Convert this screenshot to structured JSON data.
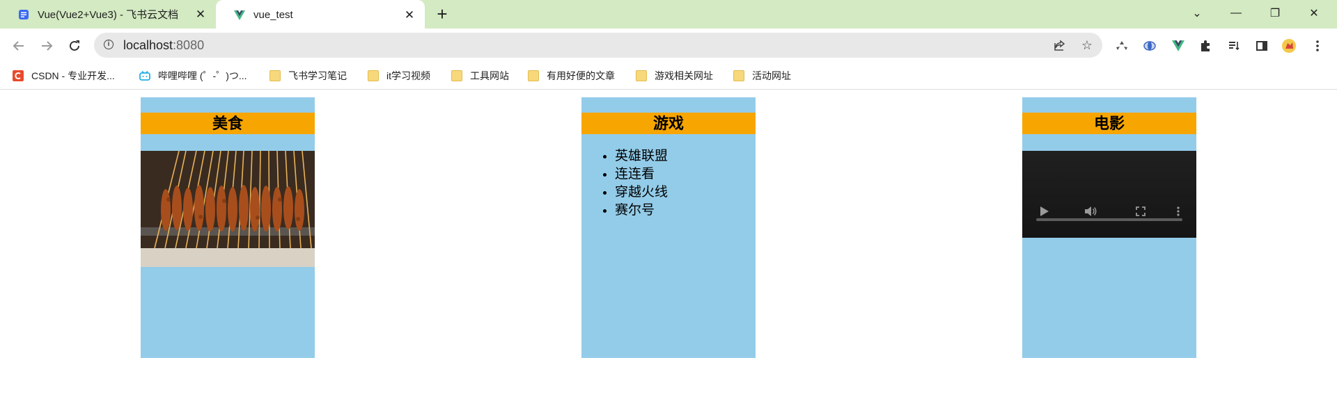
{
  "browser": {
    "tabs": [
      {
        "title": "Vue(Vue2+Vue3) - 飞书云文档",
        "close": "✕"
      },
      {
        "title": "vue_test",
        "close": "✕"
      }
    ],
    "new_tab": "+",
    "controls": {
      "tab_search": "⌄",
      "minimize": "—",
      "restore": "❐",
      "close": "✕"
    },
    "address": {
      "host": "localhost",
      "port": ":8080"
    },
    "bookmarks": [
      {
        "label": "CSDN - 专业开发...",
        "icon": "csdn-logo-icon"
      },
      {
        "label": "哔哩哔哩 (゜-゜)つ...",
        "icon": "bilibili-icon"
      },
      {
        "label": "飞书学习笔记",
        "icon": "folder-icon"
      },
      {
        "label": "it学习视频",
        "icon": "folder-icon"
      },
      {
        "label": "工具网站",
        "icon": "folder-icon"
      },
      {
        "label": "有用好便的文章",
        "icon": "folder-icon"
      },
      {
        "label": "游戏相关网址",
        "icon": "folder-icon"
      },
      {
        "label": "活动网址",
        "icon": "folder-icon"
      }
    ]
  },
  "page": {
    "categories": [
      {
        "title": "美食",
        "content": "image"
      },
      {
        "title": "游戏",
        "content": "list",
        "items": [
          "英雄联盟",
          "连连看",
          "穿越火线",
          "赛尔号"
        ]
      },
      {
        "title": "电影",
        "content": "video"
      }
    ]
  },
  "colors": {
    "box_bg": "#93cce9",
    "title_bg": "#f7a500",
    "tabbar_bg": "#d3eac2"
  }
}
